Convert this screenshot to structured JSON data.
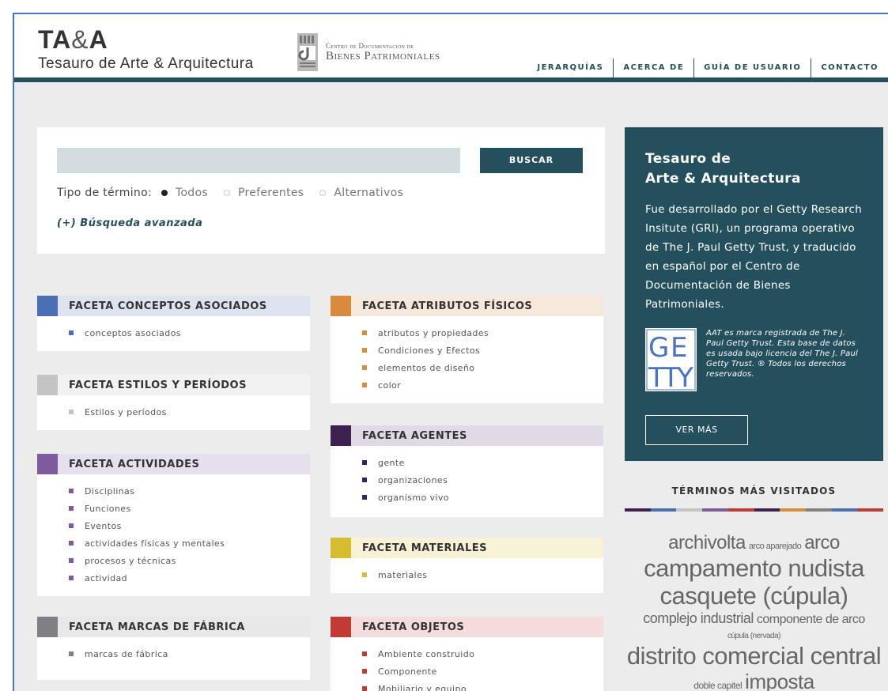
{
  "header": {
    "logo_main": "TA",
    "logo_amp": "&",
    "logo_main_end": "A",
    "logo_sub": "Tesauro de Arte & Arquitectura",
    "partner_line1": "Centro de Documentación de",
    "partner_line2": "Bienes Patrimoniales",
    "nav": [
      "JERARQUÍAS",
      "ACERCA DE",
      "GUÍA DE USUARIO",
      "CONTACTO"
    ]
  },
  "search": {
    "value": "",
    "button": "BUSCAR",
    "term_type_label": "Tipo de término:",
    "options": [
      {
        "label": "Todos",
        "selected": true
      },
      {
        "label": "Preferentes",
        "selected": false
      },
      {
        "label": "Alternativos",
        "selected": false
      }
    ],
    "advanced": "(+) Búsqueda avanzada"
  },
  "facets": [
    {
      "title": "FACETA CONCEPTOS ASOCIADOS",
      "color": "#4a6fb5",
      "head_bg": "#dde3ef",
      "items": [
        "conceptos asociados"
      ]
    },
    {
      "title": "FACETA ESTILOS Y PERÍODOS",
      "color": "#c4c4c4",
      "head_bg": "#f2f2f2",
      "items": [
        "Estilos y períodos"
      ]
    },
    {
      "title": "FACETA ACTIVIDADES",
      "color": "#7d5b9c",
      "head_bg": "#e6e0ee",
      "items": [
        "Disciplinas",
        "Funciones",
        "Eventos",
        "actividades físicas y mentales",
        "procesos y técnicas",
        "actividad"
      ]
    },
    {
      "title": "FACETA MARCAS DE FÁBRICA",
      "color": "#7f7f84",
      "head_bg": "#e8e8ea",
      "items": [
        "marcas de fábrica"
      ]
    },
    {
      "title": "FACETA ATRIBUTOS FÍSICOS",
      "color": "#d98a3c",
      "head_bg": "#f7e8dc",
      "items": [
        "atributos y propiedades",
        "Condiciones y Efectos",
        "elementos de diseño",
        "color"
      ]
    },
    {
      "title": "FACETA AGENTES",
      "color": "#3d2150",
      "head_bg": "#e0d9e6",
      "items": [
        "gente",
        "organizaciones",
        "organismo vivo"
      ]
    },
    {
      "title": "FACETA MATERIALES",
      "color": "#d4bd2e",
      "head_bg": "#f7f2d6",
      "items": [
        "materiales"
      ]
    },
    {
      "title": "FACETA OBJETOS",
      "color": "#c23a36",
      "head_bg": "#f5dcdc",
      "items": [
        "Ambiente construido",
        "Componente",
        "Mobiliario y equipo"
      ]
    }
  ],
  "info": {
    "title_l1": "Tesauro de",
    "title_l2": "Arte & Arquitectura",
    "body": "Fue desarrollado por el Getty Research Insitute (GRI), un programa operativo de The J. Paul Getty Trust, y traducido en español por el Centro de Documentación de Bienes Patrimoniales.",
    "getty_note": "AAT es marca registrada de The J. Paul Getty Trust. Esta base de datos es usada bajo licencia del The J. Paul Getty Trust. ® Todos los derechos reservados.",
    "button": "VER MÁS"
  },
  "most_visited": {
    "title": "TÉRMINOS MÁS VISITADOS",
    "stripe_colors": [
      "#3d2150",
      "#4a6fb5",
      "#c4c4c4",
      "#7d5b9c",
      "#c23a36",
      "#3d2150",
      "#d98a3c",
      "#7f7f84",
      "#4a6fb5",
      "#c23a36"
    ],
    "rows": [
      [
        {
          "t": "archivolta",
          "s": 24
        },
        {
          "t": "arco aparejado",
          "s": 11
        },
        {
          "t": "arco",
          "s": 24
        }
      ],
      [
        {
          "t": "campamento nudista",
          "s": 31
        }
      ],
      [
        {
          "t": "casquete (cúpula)",
          "s": 31
        }
      ],
      [
        {
          "t": "complejo industrial",
          "s": 18
        },
        {
          "t": "componente de arco",
          "s": 16
        }
      ],
      [
        {
          "t": "cúpula (nervada)",
          "s": 10
        }
      ],
      [
        {
          "t": "distrito comercial central",
          "s": 31
        }
      ],
      [
        {
          "t": "doble capitel",
          "s": 12
        },
        {
          "t": "imposta",
          "s": 26
        }
      ]
    ]
  }
}
